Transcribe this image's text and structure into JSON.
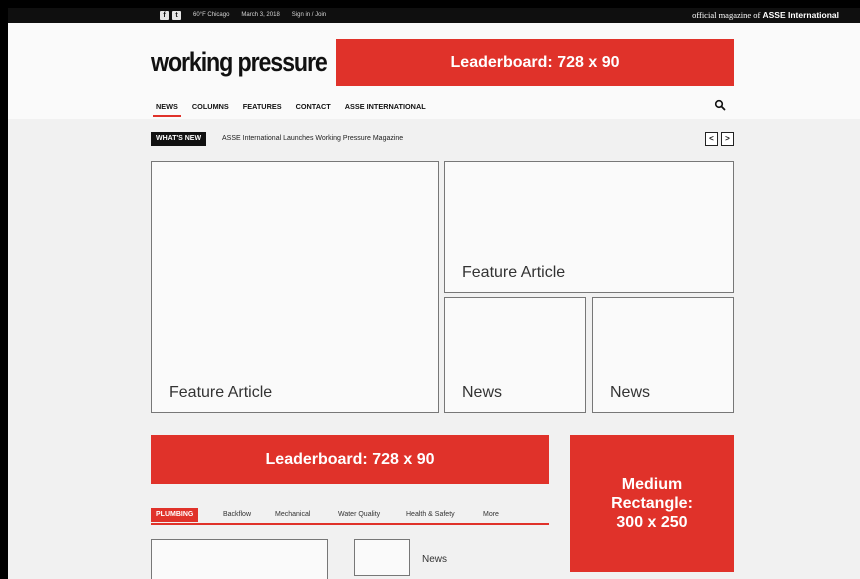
{
  "topbar": {
    "social_icons": [
      "facebook-icon",
      "twitter-icon"
    ],
    "weather": "60°F Chicago",
    "date": "March 3, 2018",
    "signin": "Sign in / Join",
    "official_prefix": "official magazine of ",
    "official_brand": "ASSE International"
  },
  "header": {
    "logo": "working pressure",
    "leaderboard_label": "Leaderboard: 728 x 90"
  },
  "nav": {
    "items": [
      "NEWS",
      "COLUMNS",
      "FEATURES",
      "CONTACT",
      "ASSE INTERNATIONAL"
    ],
    "active": "NEWS"
  },
  "ticker": {
    "badge": "WHAT'S NEW",
    "headline": "ASSE International Launches Working Pressure Magazine",
    "prev": "<",
    "next": ">"
  },
  "grid": {
    "feature_main": "Feature Article",
    "feature_secondary": "Feature Article",
    "news_1": "News",
    "news_2": "News"
  },
  "ads": {
    "leaderboard_bottom": "Leaderboard: 728 x 90",
    "medium_rectangle": [
      "Medium",
      "Rectangle:",
      "300 x 250"
    ]
  },
  "categories": {
    "active": "PLUMBING",
    "items": [
      "Backflow",
      "Mechanical",
      "Water Quality",
      "Health & Safety",
      "More"
    ]
  },
  "bottom": {
    "news_label": "News"
  },
  "colors": {
    "accent_red": "#e0322a",
    "topbar": "#0f0f0f",
    "background": "#f1f1f1"
  }
}
